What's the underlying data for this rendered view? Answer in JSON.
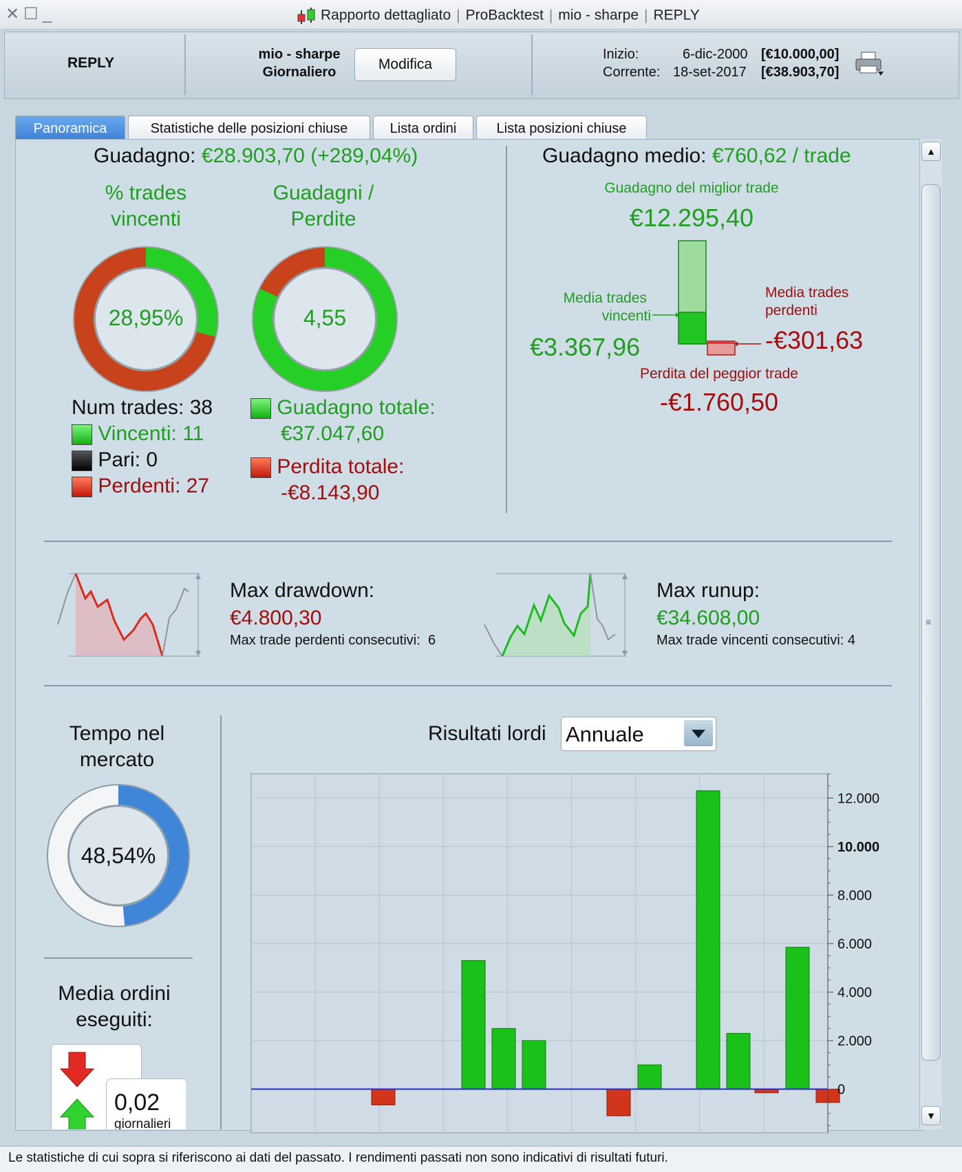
{
  "window": {
    "title": "Rapporto dettagliato",
    "crumbs": [
      "ProBacktest",
      "mio - sharpe",
      "REPLY"
    ]
  },
  "header": {
    "instrument": "REPLY",
    "strategy_name": "mio - sharpe",
    "timeframe": "Giornaliero",
    "edit_button": "Modifica",
    "start_label": "Inizio:",
    "start_date": "6-dic-2000",
    "start_capital": "[€10.000,00]",
    "current_label": "Corrente:",
    "current_date": "18-set-2017",
    "current_capital": "[€38.903,70]"
  },
  "tabs": [
    {
      "label": "Panoramica",
      "active": true
    },
    {
      "label": "Statistiche delle posizioni chiuse"
    },
    {
      "label": "Lista ordini"
    },
    {
      "label": "Lista posizioni chiuse"
    }
  ],
  "overview": {
    "gain_label": "Guadagno:",
    "gain_value": "€28.903,70 (+289,04%)",
    "win_pct_title_1": "% trades",
    "win_pct_title_2": "vincenti",
    "win_pct_value": "28,95%",
    "win_pct_fraction": 0.2895,
    "gain_loss_title_1": "Guadagni /",
    "gain_loss_title_2": "Perdite",
    "gain_loss_value": "4,55",
    "gain_loss_fraction": 0.8198,
    "num_trades": "Num trades: 38",
    "winners": "Vincenti: 11",
    "even": "Pari: 0",
    "losers": "Perdenti: 27",
    "total_gain_label": "Guadagno totale:",
    "total_gain_value": "€37.047,60",
    "total_loss_label": "Perdita totale:",
    "total_loss_value": "-€8.143,90"
  },
  "average": {
    "label": "Guadagno medio:",
    "value": "€760,62 / trade",
    "best_label": "Guadagno del miglior trade",
    "best_value": "€12.295,40",
    "avg_win_label_1": "Media trades",
    "avg_win_label_2": "vincenti",
    "avg_win_value": "€3.367,96",
    "avg_loss_label_1": "Media trades",
    "avg_loss_label_2": "perdenti",
    "avg_loss_value": "-€301,63",
    "worst_label": "Perdita del peggior trade",
    "worst_value": "-€1.760,50"
  },
  "drawdown": {
    "label": "Max drawdown:",
    "value": "€4.800,30",
    "consecutive_label": "Max trade perdenti consecutivi:",
    "consecutive_value": "6"
  },
  "runup": {
    "label": "Max runup:",
    "value": "€34.608,00",
    "consecutive_label": "Max trade vincenti consecutivi:",
    "consecutive_value": "4"
  },
  "market_time": {
    "title_1": "Tempo nel",
    "title_2": "mercato",
    "value": "48,54%",
    "fraction": 0.4854
  },
  "orders": {
    "title_1": "Media ordini",
    "title_2": "eseguiti:",
    "value": "0,02",
    "unit": "giornalieri"
  },
  "results": {
    "label": "Risultati lordi",
    "period": "Annuale"
  },
  "chart_data": {
    "type": "bar",
    "ylim": [
      -1800,
      13000
    ],
    "yticks": [
      "12.000",
      "10.000",
      "8.000",
      "6.000",
      "4.000",
      "2.000",
      "0"
    ],
    "ytick_values": [
      12000,
      10000,
      8000,
      6000,
      4000,
      2000,
      0
    ],
    "values": [
      -650,
      5300,
      2500,
      2000,
      -1100,
      1000,
      12300,
      2300,
      -150,
      5850,
      -550
    ],
    "positive_color": "#19c119",
    "negative_color": "#d3351a",
    "zero_line_color": "#2a2ad0",
    "grid": true
  },
  "footer": {
    "disclaimer": "Le statistiche di cui sopra si riferiscono ai dati del passato. I rendimenti passati non sono indicativi di risultati futuri."
  }
}
